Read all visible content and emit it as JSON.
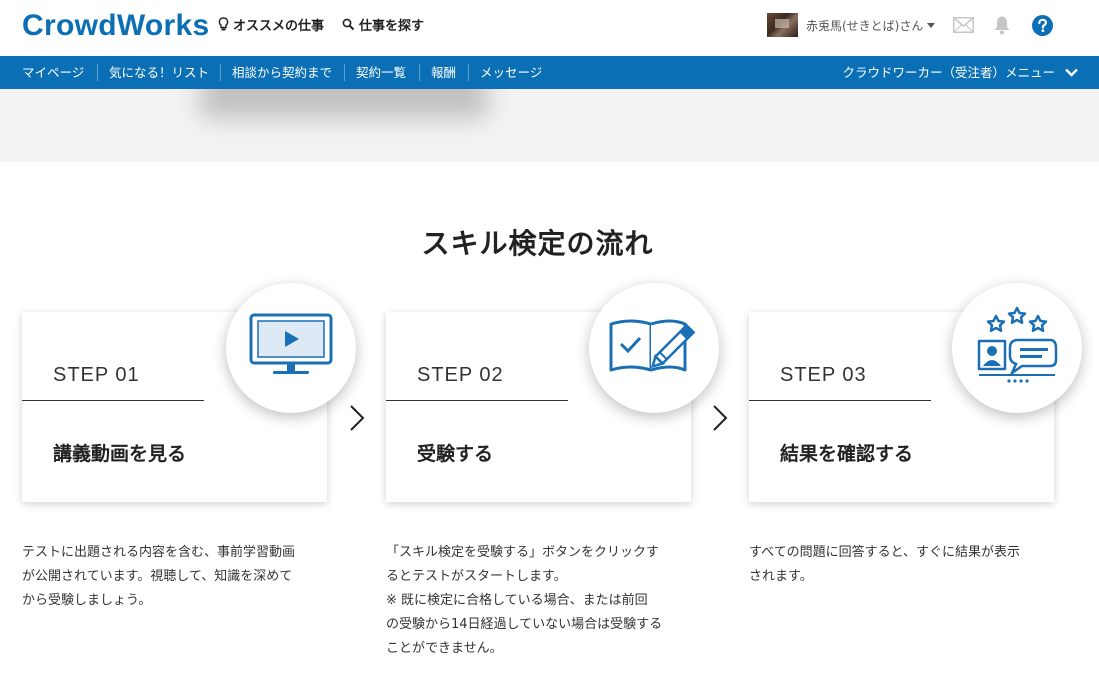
{
  "header": {
    "logo": "CrowdWorks",
    "recommended_jobs": "オススメの仕事",
    "search_jobs": "仕事を探す",
    "user_name": "赤兎馬(せきとば)さん",
    "icons": [
      "mail-icon",
      "bell-icon",
      "help-icon"
    ]
  },
  "nav": {
    "items": [
      "マイページ",
      "気になる！リスト",
      "相談から契約まで",
      "契約一覧",
      "報酬",
      "メッセージ"
    ],
    "menu": "クラウドワーカー（受注者）メニュー"
  },
  "section": {
    "title": "スキル検定の流れ"
  },
  "steps": [
    {
      "step": "STEP 01",
      "title": "講義動画を見る",
      "icon": "video-monitor-icon",
      "desc": [
        "テストに出題される内容を含む、事前学習動画",
        "が公開されています。視聴して、知識を深めて",
        "から受験しましょう。"
      ]
    },
    {
      "step": "STEP 02",
      "title": "受験する",
      "icon": "book-pencil-icon",
      "desc": [
        "「スキル検定を受験する」ボタンをクリックす",
        "るとテストがスタートします。",
        "※ 既に検定に合格している場合、または前回",
        "の受験から14日経過していない場合は受験する",
        "ことができません。"
      ]
    },
    {
      "step": "STEP 03",
      "title": "結果を確認する",
      "icon": "result-profile-stars-icon",
      "desc": [
        "すべての問題に回答すると、すぐに結果が表示",
        "されます。"
      ]
    }
  ],
  "colors": {
    "brand": "#0a6fb4",
    "icon_blue": "#1a6fb5"
  }
}
